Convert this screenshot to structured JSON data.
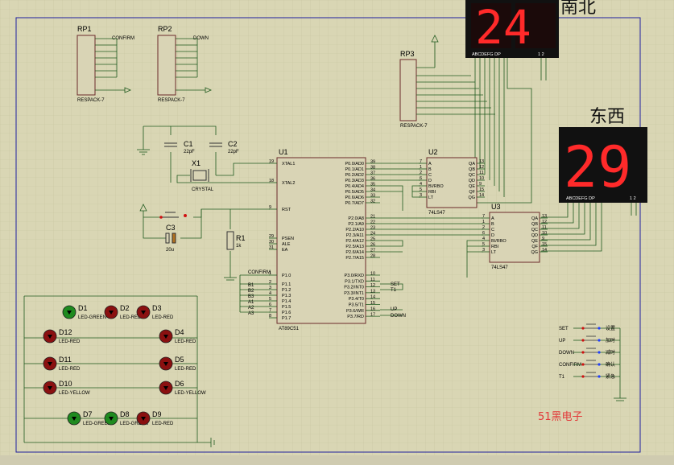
{
  "chips": {
    "u1": {
      "ref": "U1",
      "part": "AT89C51",
      "left_pins": [
        [
          "19",
          "XTAL1"
        ],
        [
          "18",
          "XTAL2"
        ],
        [
          "9",
          "RST"
        ],
        [
          "29",
          "PSEN"
        ],
        [
          "30",
          "ALE"
        ],
        [
          "31",
          "EA"
        ],
        [
          "1",
          "P1.0"
        ],
        [
          "2",
          "P1.1"
        ],
        [
          "3",
          "P1.2"
        ],
        [
          "4",
          "P1.3"
        ],
        [
          "5",
          "P1.4"
        ],
        [
          "6",
          "P1.5"
        ],
        [
          "7",
          "P1.6"
        ],
        [
          "8",
          "P1.7"
        ]
      ],
      "right_pins": [
        [
          "39",
          "P0.0/AD0"
        ],
        [
          "38",
          "P0.1/AD1"
        ],
        [
          "37",
          "P0.2/AD2"
        ],
        [
          "36",
          "P0.3/AD3"
        ],
        [
          "35",
          "P0.4/AD4"
        ],
        [
          "34",
          "P0.5/AD5"
        ],
        [
          "33",
          "P0.6/AD6"
        ],
        [
          "32",
          "P0.7/AD7"
        ],
        [
          "21",
          "P2.0/A8"
        ],
        [
          "22",
          "P2.1/A9"
        ],
        [
          "23",
          "P2.2/A10"
        ],
        [
          "24",
          "P2.3/A11"
        ],
        [
          "25",
          "P2.4/A12"
        ],
        [
          "26",
          "P2.5/A13"
        ],
        [
          "27",
          "P2.6/A14"
        ],
        [
          "28",
          "P2.7/A15"
        ],
        [
          "10",
          "P3.0/RXD"
        ],
        [
          "11",
          "P3.1/TXD"
        ],
        [
          "12",
          "P3.2/INT0"
        ],
        [
          "13",
          "P3.3/INT1"
        ],
        [
          "14",
          "P3.4/T0"
        ],
        [
          "15",
          "P3.5/T1"
        ],
        [
          "16",
          "P3.6/WR"
        ],
        [
          "17",
          "P3.7/RD"
        ]
      ]
    },
    "u2": {
      "ref": "U2",
      "part": "74LS47",
      "left_pins": [
        [
          "7",
          "A"
        ],
        [
          "1",
          "B"
        ],
        [
          "2",
          "C"
        ],
        [
          "6",
          "D"
        ],
        [
          "4",
          "BI/RBO"
        ],
        [
          "5",
          "RBI"
        ],
        [
          "3",
          "LT"
        ]
      ],
      "right_pins": [
        [
          "13",
          "QA"
        ],
        [
          "12",
          "QB"
        ],
        [
          "11",
          "QC"
        ],
        [
          "10",
          "QD"
        ],
        [
          "9",
          "QE"
        ],
        [
          "15",
          "QF"
        ],
        [
          "14",
          "QG"
        ]
      ]
    },
    "u3": {
      "ref": "U3",
      "part": "74LS47",
      "left_pins": [
        [
          "7",
          "A"
        ],
        [
          "1",
          "B"
        ],
        [
          "2",
          "C"
        ],
        [
          "6",
          "D"
        ],
        [
          "4",
          "BI/RBO"
        ],
        [
          "5",
          "RBI"
        ],
        [
          "3",
          "LT"
        ]
      ],
      "right_pins": [
        [
          "13",
          "QA"
        ],
        [
          "12",
          "QB"
        ],
        [
          "11",
          "QC"
        ],
        [
          "10",
          "QD"
        ],
        [
          "9",
          "QE"
        ],
        [
          "15",
          "QF"
        ],
        [
          "14",
          "QG"
        ]
      ]
    }
  },
  "respacks": {
    "rp1": {
      "ref": "RP1",
      "part": "RESPACK-7",
      "net": "CONFIRM",
      "pins": [
        "8",
        "7",
        "6",
        "5",
        "4",
        "3",
        "2",
        "1"
      ]
    },
    "rp2": {
      "ref": "RP2",
      "part": "RESPACK-7",
      "net": "DOWN",
      "pins": [
        "8",
        "7",
        "6",
        "5",
        "4",
        "3",
        "2",
        "1"
      ]
    },
    "rp3": {
      "ref": "RP3",
      "part": "RESPACK-7",
      "pins": [
        "1",
        "2",
        "3",
        "4",
        "5",
        "6",
        "7",
        "8"
      ]
    }
  },
  "passives": {
    "c1": {
      "ref": "C1",
      "value": "22pF"
    },
    "c2": {
      "ref": "C2",
      "value": "22pF"
    },
    "x1": {
      "ref": "X1",
      "value": "CRYSTAL"
    },
    "c3": {
      "ref": "C3",
      "value": "20u"
    },
    "r1": {
      "ref": "R1",
      "value": "1k"
    }
  },
  "displays": {
    "top": {
      "label_partial": "南北",
      "digits": "24",
      "pin_label": "ABCDEFG  DP",
      "pin_nums": "1 2"
    },
    "right": {
      "label": "东西",
      "digits": "29",
      "pin_label": "ABCDEFG  DP",
      "pin_nums": "1 2"
    }
  },
  "nets": {
    "confirm": "CONFIRM",
    "b1": "B1",
    "b2": "B2",
    "b3": "B3",
    "a1": "A1",
    "a2": "A2",
    "a3": "A3",
    "set": "SET",
    "t1": "T1",
    "up": "UP",
    "down": "DOWN"
  },
  "switches": [
    {
      "net": "SET",
      "label": "设置"
    },
    {
      "net": "UP",
      "label": "加时"
    },
    {
      "net": "DOWN",
      "label": "减时"
    },
    {
      "net": "CONFIRM",
      "label": "确认"
    },
    {
      "net": "T1",
      "label": "紧急"
    }
  ],
  "leds": [
    {
      "ref": "D1",
      "part": "LED-GREEN"
    },
    {
      "ref": "D2",
      "part": "LED-RED"
    },
    {
      "ref": "D3",
      "part": "LED-RED"
    },
    {
      "ref": "D12",
      "part": "LED-RED"
    },
    {
      "ref": "D4",
      "part": "LED-RED"
    },
    {
      "ref": "D11",
      "part": "LED-RED"
    },
    {
      "ref": "D5",
      "part": "LED-RED"
    },
    {
      "ref": "D10",
      "part": "LED-YELLOW"
    },
    {
      "ref": "D6",
      "part": "LED-YELLOW"
    },
    {
      "ref": "D7",
      "part": "LED-GREEN"
    },
    {
      "ref": "D8",
      "part": "LED-GREEN"
    },
    {
      "ref": "D9",
      "part": "LED-RED"
    }
  ],
  "watermark": "51黑电子",
  "colors": {
    "background": "#d9d6b4",
    "wire": "#1f5a1f",
    "component_fill": "#d9d4b5",
    "component_outline": "#6b2a2a",
    "segment_on": "#ff2a2a",
    "display_body": "#111111",
    "frame": "#2020a0",
    "pin_red": "#d01010",
    "pin_blue": "#2040ff",
    "watermark": "#e23a3a"
  }
}
